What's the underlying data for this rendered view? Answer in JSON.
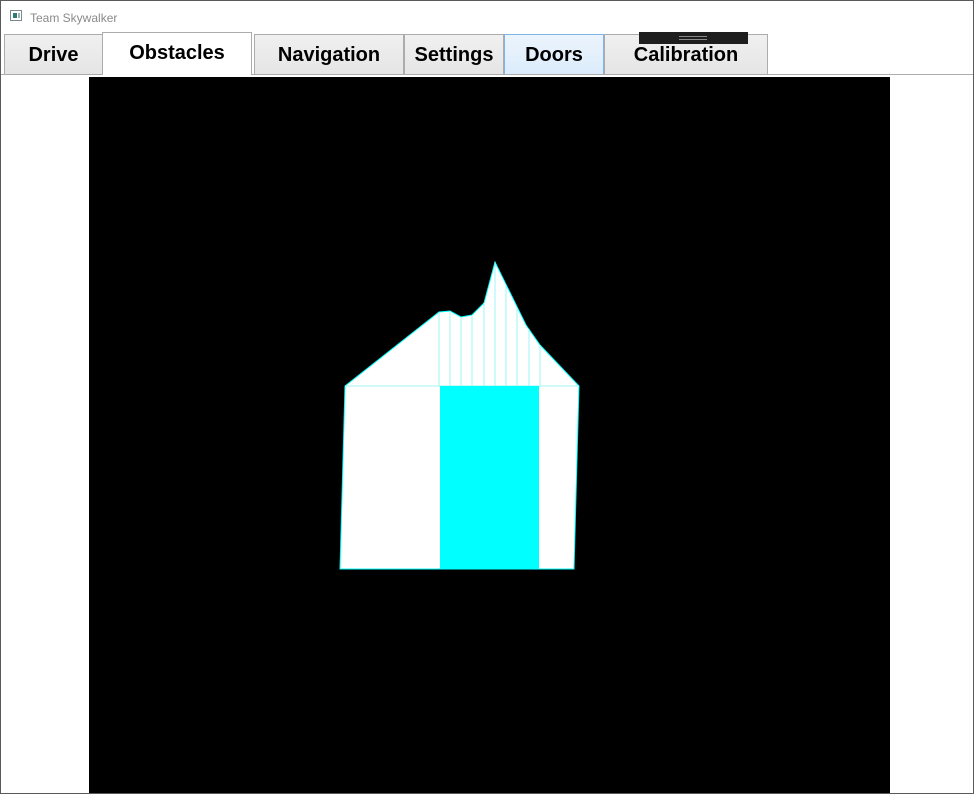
{
  "window": {
    "title": "Team Skywalker",
    "icon": "app-window-icon"
  },
  "tabs": [
    {
      "label": "Drive",
      "state": "normal"
    },
    {
      "label": "Obstacles",
      "state": "selected"
    },
    {
      "label": "Navigation",
      "state": "normal"
    },
    {
      "label": "Settings",
      "state": "normal"
    },
    {
      "label": "Doors",
      "state": "hover"
    },
    {
      "label": "Calibration",
      "state": "normal"
    }
  ],
  "obstacle_view": {
    "background_color": "#000000",
    "region_color": "#ffffff",
    "outline_color": "#00ffff",
    "door_color": "#00ffff"
  }
}
